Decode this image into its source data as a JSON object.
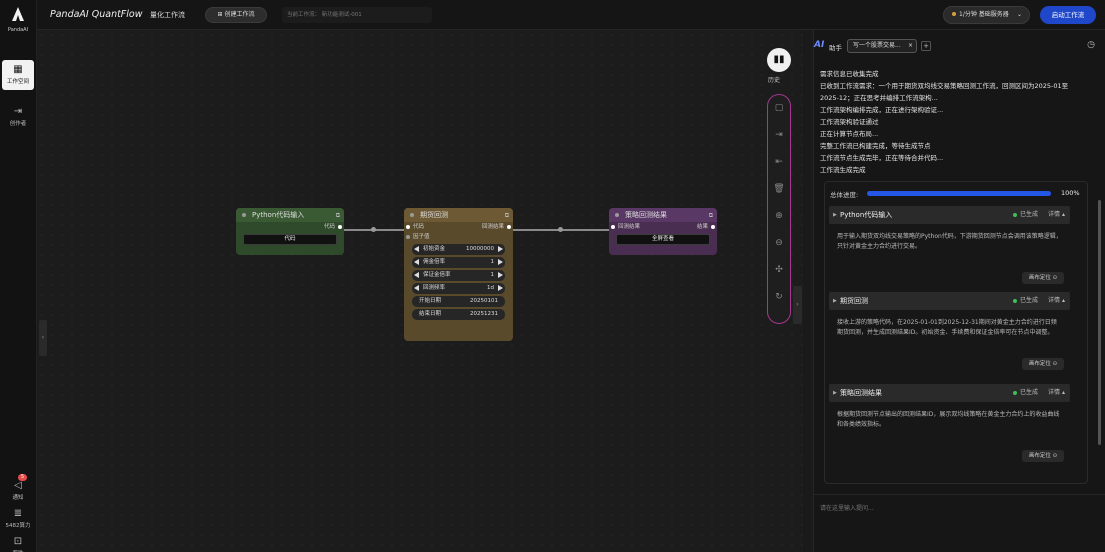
{
  "app": {
    "title": "PandaAI QuantFlow",
    "subtitle": "量化工作流",
    "logo_text": "PandaAI"
  },
  "rail": {
    "workspace": "工作空间",
    "creator": "创作者",
    "notify": "通知",
    "notify_count": "5",
    "compute": "5482算力",
    "bottom": "帮助"
  },
  "topbar": {
    "create_button": "创建工作流",
    "current_workflow": "当前工作流：  新功能测试-001",
    "server": "1/分钟  基础服务器",
    "start_button": "启动工作流"
  },
  "nodes": {
    "python": {
      "title": "Python代码输入",
      "out_port": "代码",
      "field": "代码"
    },
    "backtest": {
      "title": "期货回测",
      "in_port": "代码",
      "out_port": "回测结果",
      "extra_port": "因子值",
      "params": [
        {
          "label": "初始资金",
          "value": "10000000",
          "stepper": true
        },
        {
          "label": "佣金倍率",
          "value": "1",
          "stepper": true
        },
        {
          "label": "保证金倍率",
          "value": "1",
          "stepper": true
        },
        {
          "label": "回测频率",
          "value": "1d",
          "stepper": true
        },
        {
          "label": "开始日期",
          "value": "20250101",
          "stepper": false
        },
        {
          "label": "结束日期",
          "value": "20251231",
          "stepper": false
        }
      ]
    },
    "result": {
      "title": "策略回测结果",
      "in_port": "回测结果",
      "out_port": "结果",
      "field": "全屏查看"
    }
  },
  "toolbar": {
    "history_label": "历史"
  },
  "assistant": {
    "ai_logo": "AI",
    "title": "助手",
    "tab": "写一个股票交易...",
    "log": [
      "需求信息已收集完成",
      "已收到工作流需求：一个用于期货双均线交易策略回测工作流，回测区间为2025-01至2025-12；正在思考并编排工作流架构...",
      "工作流架构编排完成，正在进行架构验证...",
      "工作流架构验证通过",
      "正在计算节点布局...",
      "完整工作流已构建完成，等待生成节点",
      "工作流节点生成完毕，正在等待合并代码...",
      "工作流生成完成"
    ],
    "progress_label": "总体进度:",
    "progress_percent": "100%",
    "progress_value": 100,
    "steps": [
      {
        "title": "Python代码输入",
        "status": "已生成",
        "detail": "详情",
        "desc": "用于输入期货双均线交易策略的Python代码，下游期货回测节点会调用该策略逻辑，只针对黄金主力合约进行交易。",
        "locate": "画布定位"
      },
      {
        "title": "期货回测",
        "status": "已生成",
        "detail": "详情",
        "desc": "接收上游的策略代码，在2025-01-01到2025-12-31期间对黄金主力合约进行日频期货回测，并生成回测结果ID。初始资金、手续费和保证金倍率可在节点中调整。",
        "locate": "画布定位"
      },
      {
        "title": "策略回测结果",
        "status": "已生成",
        "detail": "详情",
        "desc": "根据期货回测节点输出的回测结果ID，展示双均线策略在黄金主力合约上的收益曲线和各类绩效指标。",
        "locate": "画布定位"
      }
    ],
    "input_placeholder": "请在这里输入提问..."
  }
}
